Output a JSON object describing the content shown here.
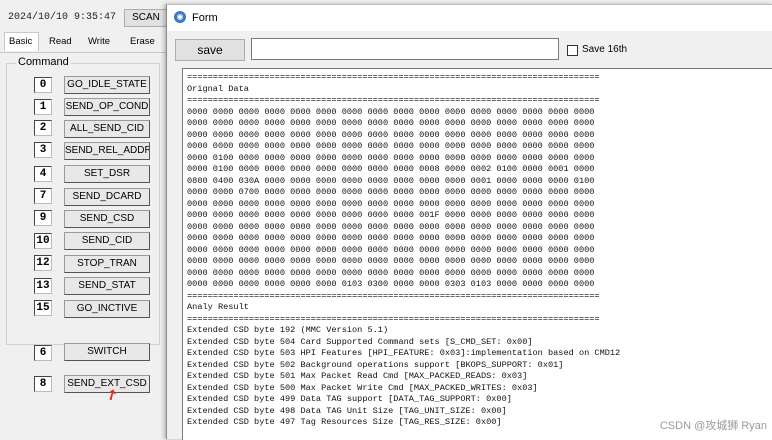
{
  "main_window": {
    "datetime": "2024/10/10 9:35:47",
    "scan_label": "SCAN",
    "tabs": [
      "Basic",
      "Read",
      "Write",
      "Erase"
    ],
    "group_label": "Command",
    "commands": [
      {
        "num": "0",
        "label": "GO_IDLE_STATE"
      },
      {
        "num": "1",
        "label": "SEND_OP_COND"
      },
      {
        "num": "2",
        "label": "ALL_SEND_CID"
      },
      {
        "num": "3",
        "label": "SEND_REL_ADDR"
      },
      {
        "num": "4",
        "label": "SET_DSR"
      },
      {
        "num": "7",
        "label": "SEND_DCARD"
      },
      {
        "num": "9",
        "label": "SEND_CSD"
      },
      {
        "num": "10",
        "label": "SEND_CID"
      },
      {
        "num": "12",
        "label": "STOP_TRAN"
      },
      {
        "num": "13",
        "label": "SEND_STAT"
      },
      {
        "num": "15",
        "label": "GO_INCTIVE"
      },
      {
        "num": "6",
        "label": "SWITCH"
      },
      {
        "num": "8",
        "label": "SEND_EXT_CSD"
      }
    ]
  },
  "form": {
    "title": "Form",
    "save_label": "save",
    "path_value": "",
    "save16_label": "Save 16th",
    "save16_checked": false,
    "separator": "================================================================================",
    "orig_header": "Orignal Data",
    "hex_rows": [
      "0000 0000 0000 0000 0000 0000 0000 0000 0000 0000 0000 0000 0000 0000 0000 0000",
      "0000 0000 0000 0000 0000 0000 0000 0000 0000 0000 0000 0000 0000 0000 0000 0000",
      "0000 0000 0000 0000 0000 0000 0000 0000 0000 0000 0000 0000 0000 0000 0000 0000",
      "0000 0000 0000 0000 0000 0000 0000 0000 0000 0000 0000 0000 0000 0000 0000 0000",
      "0000 0100 0000 0000 0000 0000 0000 0000 0000 0000 0000 0000 0000 0000 0000 0000",
      "0000 0100 0000 0000 0000 0000 0000 0000 0000 0008 0000 0002 0100 0000 0001 0000",
      "0800 0400 030A 0000 0000 0000 0000 0000 0000 0000 0000 0001 0000 0000 0000 0100",
      "0000 0000 0700 0000 0000 0000 0000 0000 0000 0000 0000 0000 0000 0000 0000 0000",
      "0000 0000 0000 0000 0000 0000 0000 0000 0000 0000 0000 0000 0000 0000 0000 0000",
      "0000 0000 0000 0000 0000 0000 0000 0000 0000 001F 0000 0000 0000 0000 0000 0000",
      "0000 0000 0000 0000 0000 0000 0000 0000 0000 0000 0000 0000 0000 0000 0000 0000",
      "0000 0000 0000 0000 0000 0000 0000 0000 0000 0000 0000 0000 0000 0000 0000 0000",
      "0000 0000 0000 0000 0000 0000 0000 0000 0000 0000 0000 0000 0000 0000 0000 0000",
      "0000 0000 0000 0000 0000 0000 0000 0000 0000 0000 0000 0000 0000 0000 0000 0000",
      "0000 0000 0000 0000 0000 0000 0000 0000 0000 0000 0000 0000 0000 0000 0000 0000",
      "0000 0000 0000 0000 0000 0000 0103 0300 0000 0000 0303 0103 0000 0000 0000 0000"
    ],
    "analy_header": "Analy Result",
    "analy_lines": [
      "Extended CSD byte 192 (MMC Version 5.1)",
      "Extended CSD byte 504 Card Supported Command sets [S_CMD_SET: 0x00]",
      "Extended CSD byte 503 HPI Features [HPI_FEATURE: 0x03]:implementation based on CMD12",
      "Extended CSD byte 502 Background operations support [BKOPS_SUPPORT: 0x01]",
      "Extended CSD byte 501 Max Packet Read Cmd [MAX_PACKED_READS: 0x03]",
      "Extended CSD byte 500 Max Packet Write Cmd [MAX_PACKED_WRITES: 0x03]",
      "Extended CSD byte 499 Data TAG support [DATA_TAG_SUPPORT: 0x00]",
      "Extended CSD byte 498 Data TAG Unit Size [TAG_UNIT_SIZE: 0x00]",
      "Extended CSD byte 497 Tag Resources Size [TAG_RES_SIZE: 0x00]"
    ]
  },
  "watermark": "CSDN @攻城狮 Ryan"
}
